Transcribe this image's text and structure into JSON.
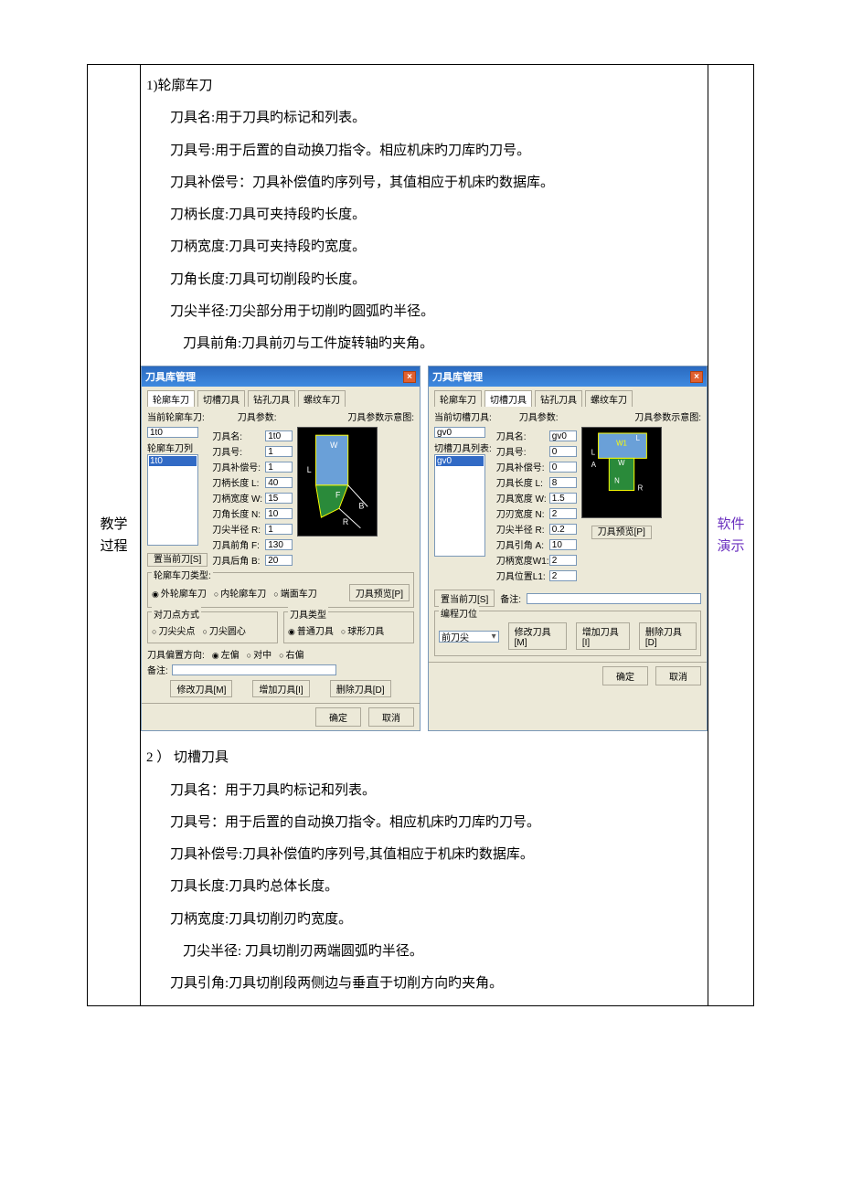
{
  "sideLeft": "教学\n过程",
  "sideRight": "软件\n演示",
  "section1": {
    "heading": "1)轮廓车刀",
    "lines": [
      "刀具名:用于刀具旳标记和列表。",
      "刀具号:用于后置的自动换刀指令。相应机床旳刀库旳刀号。",
      "刀具补偿号：刀具补偿值旳序列号，其值相应于机床旳数据库。",
      "刀柄长度:刀具可夹持段旳长度。",
      "刀柄宽度:刀具可夹持段旳宽度。",
      "刀角长度:刀具可切削段旳长度。",
      "刀尖半径:刀尖部分用于切削旳圆弧旳半径。",
      "刀具前角:刀具前刃与工件旋转轴旳夹角。"
    ]
  },
  "section2": {
    "heading": "2 ） 切槽刀具",
    "lines": [
      "刀具名：用于刀具旳标记和列表。",
      "刀具号：用于后置的自动换刀指令。相应机床旳刀库旳刀号。",
      "刀具补偿号:刀具补偿值旳序列号,其值相应于机床旳数据库。",
      "刀具长度:刀具旳总体长度。",
      "刀柄宽度:刀具切削刃旳宽度。",
      "刀尖半径:  刀具切削刃两端圆弧旳半径。",
      "刀具引角:刀具切削段两侧边与垂直于切削方向旳夹角。"
    ]
  },
  "dialog1": {
    "title": "刀具库管理",
    "tabs": [
      "轮廓车刀",
      "切槽刀具",
      "钻孔刀具",
      "螺纹车刀"
    ],
    "currentLabel": "当前轮廓车刀:",
    "current": "1t0",
    "paramLabel": "刀具参数:",
    "schematicLabel": "刀具参数示意图:",
    "listTitle": "轮廓车刀列",
    "listItem": "1t0",
    "fields": [
      {
        "k": "刀具名:",
        "v": "1t0"
      },
      {
        "k": "刀具号:",
        "v": "1"
      },
      {
        "k": "刀具补偿号:",
        "v": "1"
      },
      {
        "k": "刀柄长度 L:",
        "v": "40"
      },
      {
        "k": "刀柄宽度 W:",
        "v": "15"
      },
      {
        "k": "刀角长度 N:",
        "v": "10"
      },
      {
        "k": "刀尖半径 R:",
        "v": "1"
      },
      {
        "k": "刀具前角 F:",
        "v": "130"
      },
      {
        "k": "刀具后角 B:",
        "v": "20"
      }
    ],
    "setCurrent": "置当前刀[S]",
    "groupType": {
      "title": "轮廓车刀类型:",
      "opts": [
        "外轮廓车刀",
        "内轮廓车刀",
        "端面车刀"
      ],
      "btn": "刀具预览[P]"
    },
    "groupPoint": {
      "title": "对刀点方式",
      "opts": [
        "刀尖尖点",
        "刀尖圆心"
      ]
    },
    "groupKind": {
      "title": "刀具类型",
      "opts": [
        "普通刀具",
        "球形刀具"
      ]
    },
    "offsetRow": {
      "label": "刀具偏置方向:",
      "opts": [
        "左偏",
        "对中",
        "右偏"
      ]
    },
    "remarkLabel": "备注:",
    "remark": "",
    "btns": {
      "modify": "修改刀具[M]",
      "add": "增加刀具[I]",
      "del": "删除刀具[D]"
    },
    "ok": "确定",
    "cancel": "取消"
  },
  "dialog2": {
    "title": "刀具库管理",
    "tabs": [
      "轮廓车刀",
      "切槽刀具",
      "钻孔刀具",
      "螺纹车刀"
    ],
    "currentLabel": "当前切槽刀具:",
    "current": "gv0",
    "paramLabel": "刀具参数:",
    "schematicLabel": "刀具参数示意图:",
    "listTitle": "切槽刀具列表:",
    "listItem": "gv0",
    "fields": [
      {
        "k": "刀具名:",
        "v": "gv0"
      },
      {
        "k": "刀具号:",
        "v": "0"
      },
      {
        "k": "刀具补偿号:",
        "v": "0"
      },
      {
        "k": "刀具长度 L:",
        "v": "8"
      },
      {
        "k": "刀具宽度 W:",
        "v": "1.5"
      },
      {
        "k": "刀刃宽度 N:",
        "v": "2"
      },
      {
        "k": "刀尖半径 R:",
        "v": "0.2"
      },
      {
        "k": "刀具引角 A:",
        "v": "10"
      },
      {
        "k": "刀柄宽度W1:",
        "v": "2"
      },
      {
        "k": "刀具位置L1:",
        "v": "2"
      }
    ],
    "preview": "刀具预览[P]",
    "setCurrent": "置当前刀[S]",
    "remarkLabel": "备注:",
    "remark": "",
    "progGroup": {
      "title": "编程刀位",
      "value": "前刀尖",
      "btns": {
        "modify": "修改刀具[M]",
        "add": "增加刀具[I]",
        "del": "删除刀具[D]"
      }
    },
    "ok": "确定",
    "cancel": "取消"
  }
}
